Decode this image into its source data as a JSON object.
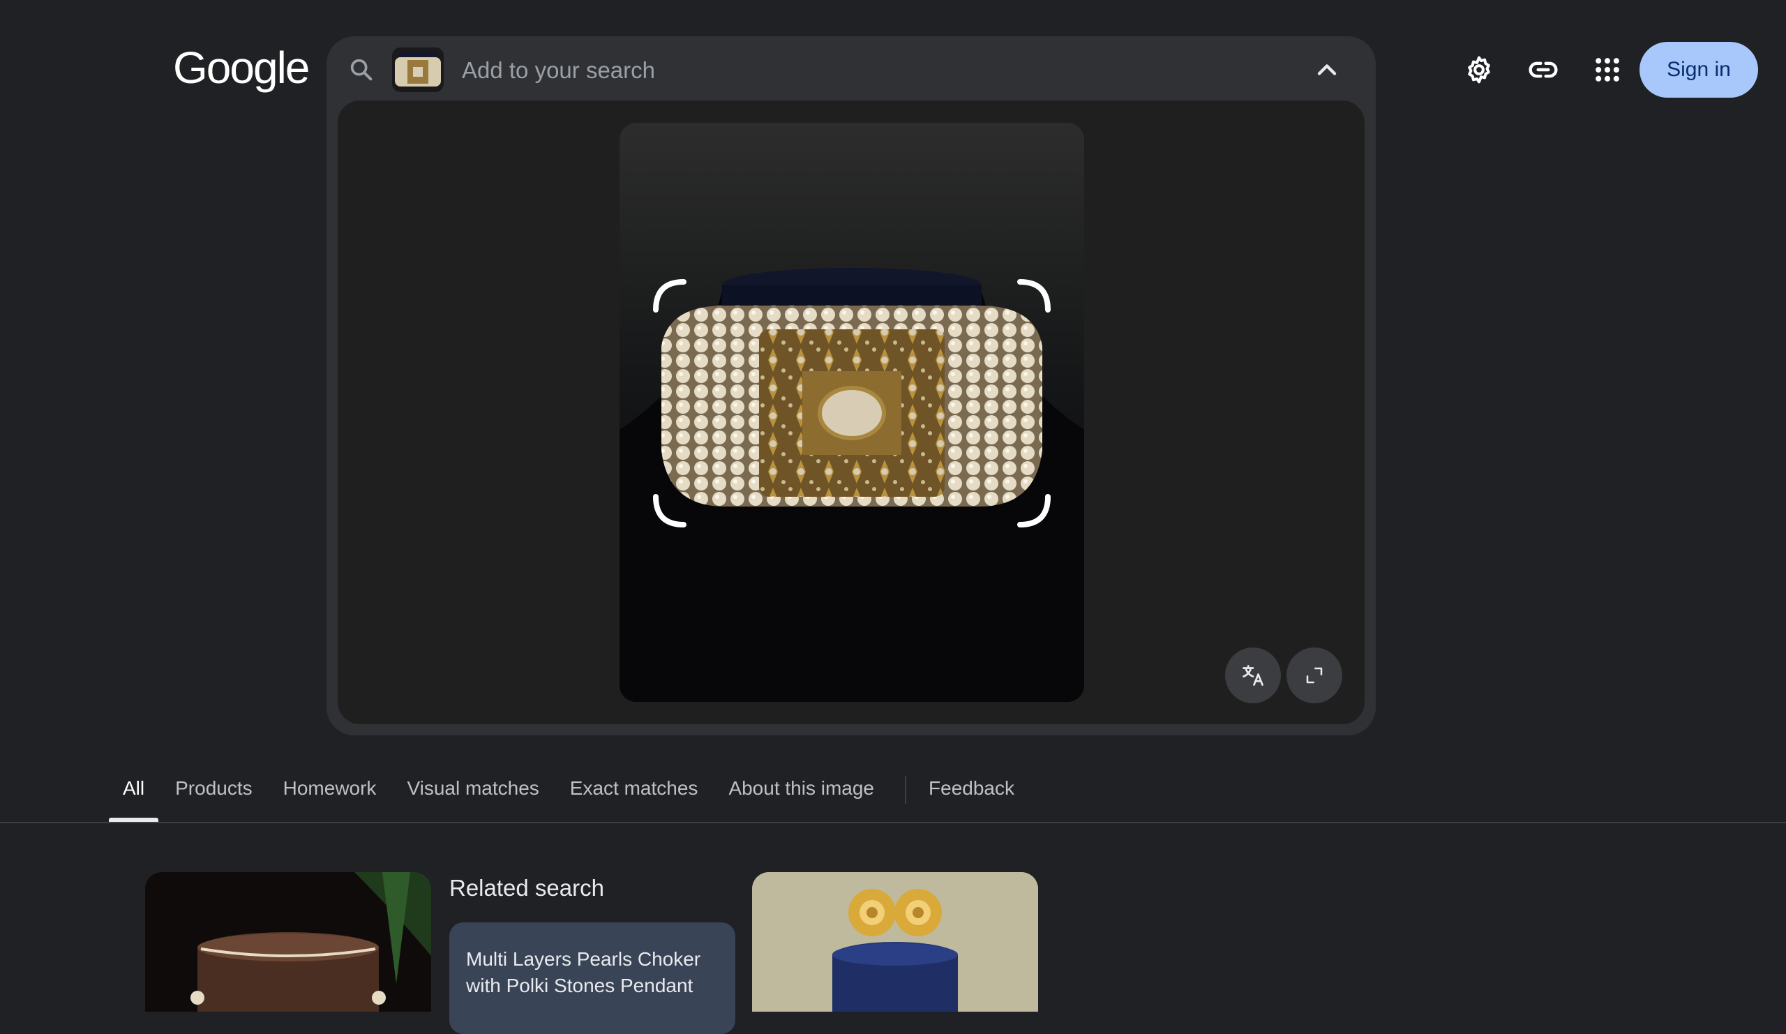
{
  "header": {
    "logo_text": "Google",
    "search": {
      "placeholder": "Add to your search",
      "value": ""
    },
    "sign_in_label": "Sign in"
  },
  "icons": {
    "search": "search-icon",
    "collapse": "chevron-up-icon",
    "settings": "gear-icon",
    "link": "link-icon",
    "apps": "apps-grid-icon",
    "translate": "translate-icon",
    "expand": "expand-icon"
  },
  "tabs": [
    {
      "label": "All",
      "active": true
    },
    {
      "label": "Products",
      "active": false
    },
    {
      "label": "Homework",
      "active": false
    },
    {
      "label": "Visual matches",
      "active": false
    },
    {
      "label": "Exact matches",
      "active": false
    },
    {
      "label": "About this image",
      "active": false
    },
    {
      "label": "Feedback",
      "active": false
    }
  ],
  "results": {
    "related_title": "Related search",
    "related_query": "Multi Layers Pearls Choker with Polki Stones Pendant"
  },
  "colors": {
    "background": "#202124",
    "search_bar": "#303134",
    "sign_in_bg": "#a8c7fa",
    "related_card": "#394457"
  }
}
